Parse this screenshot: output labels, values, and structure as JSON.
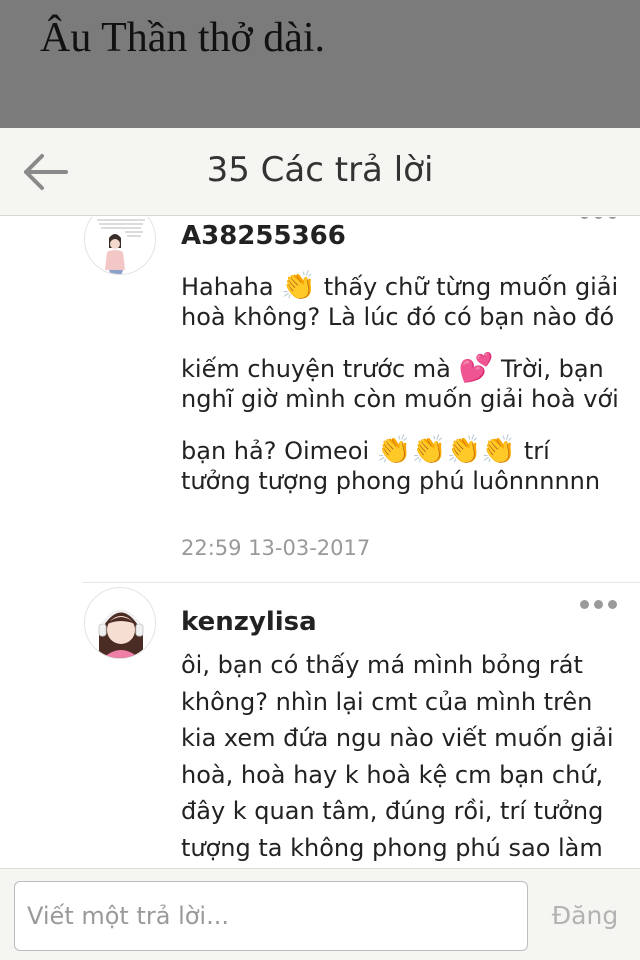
{
  "background_story": {
    "text": "Âu Thần thở dài."
  },
  "header": {
    "back_icon": "arrow-left-icon",
    "title": "35 Các trả lời"
  },
  "comments": [
    {
      "username": "A38255366",
      "avatar": "girl-illustration-with-text",
      "lines": [
        {
          "segments": [
            {
              "text": "Hahaha "
            },
            {
              "emoji": "👏"
            },
            {
              "text": " thấy chữ từng muốn giải"
            }
          ]
        },
        {
          "segments": [
            {
              "text": "hoà không? Là lúc đó có bạn nào đó"
            }
          ]
        },
        {
          "segments": [
            {
              "text": "kiếm chuyện trước mà "
            },
            {
              "emoji": "💕"
            },
            {
              "text": " Trời, bạn"
            }
          ]
        },
        {
          "segments": [
            {
              "text": "nghĩ giờ mình còn muốn giải hoà với"
            }
          ]
        },
        {
          "segments": [
            {
              "text": "bạn hả? Oimeoi "
            },
            {
              "emoji": "👏👏👏👏"
            },
            {
              "text": " trí"
            }
          ]
        },
        {
          "segments": [
            {
              "text": "tưởng tượng phong phú luônnnnnn"
            }
          ]
        }
      ],
      "timestamp": "22:59 13-03-2017"
    },
    {
      "username": "kenzylisa",
      "avatar": "girl-with-headphones-illustration",
      "lines": [
        "ôi, bạn có thấy má mình bỏng rát",
        "không? nhìn lại cmt của mình trên",
        "kia xem đứa ngu nào viết muốn giải",
        "hoà, hoà hay k hoà kệ cm bạn chứ,",
        "đây k quan tâm, đúng rồi, trí tưởng",
        "tượng ta không phong phú sao làm"
      ]
    }
  ],
  "composer": {
    "placeholder": "Viết một trả lời...",
    "post_label": "Đăng"
  },
  "colors": {
    "header_bg": "#f5f5f1",
    "overlay_bg": "#7b7b7b",
    "muted_text": "#999999",
    "post_disabled": "#b3b3b3"
  }
}
